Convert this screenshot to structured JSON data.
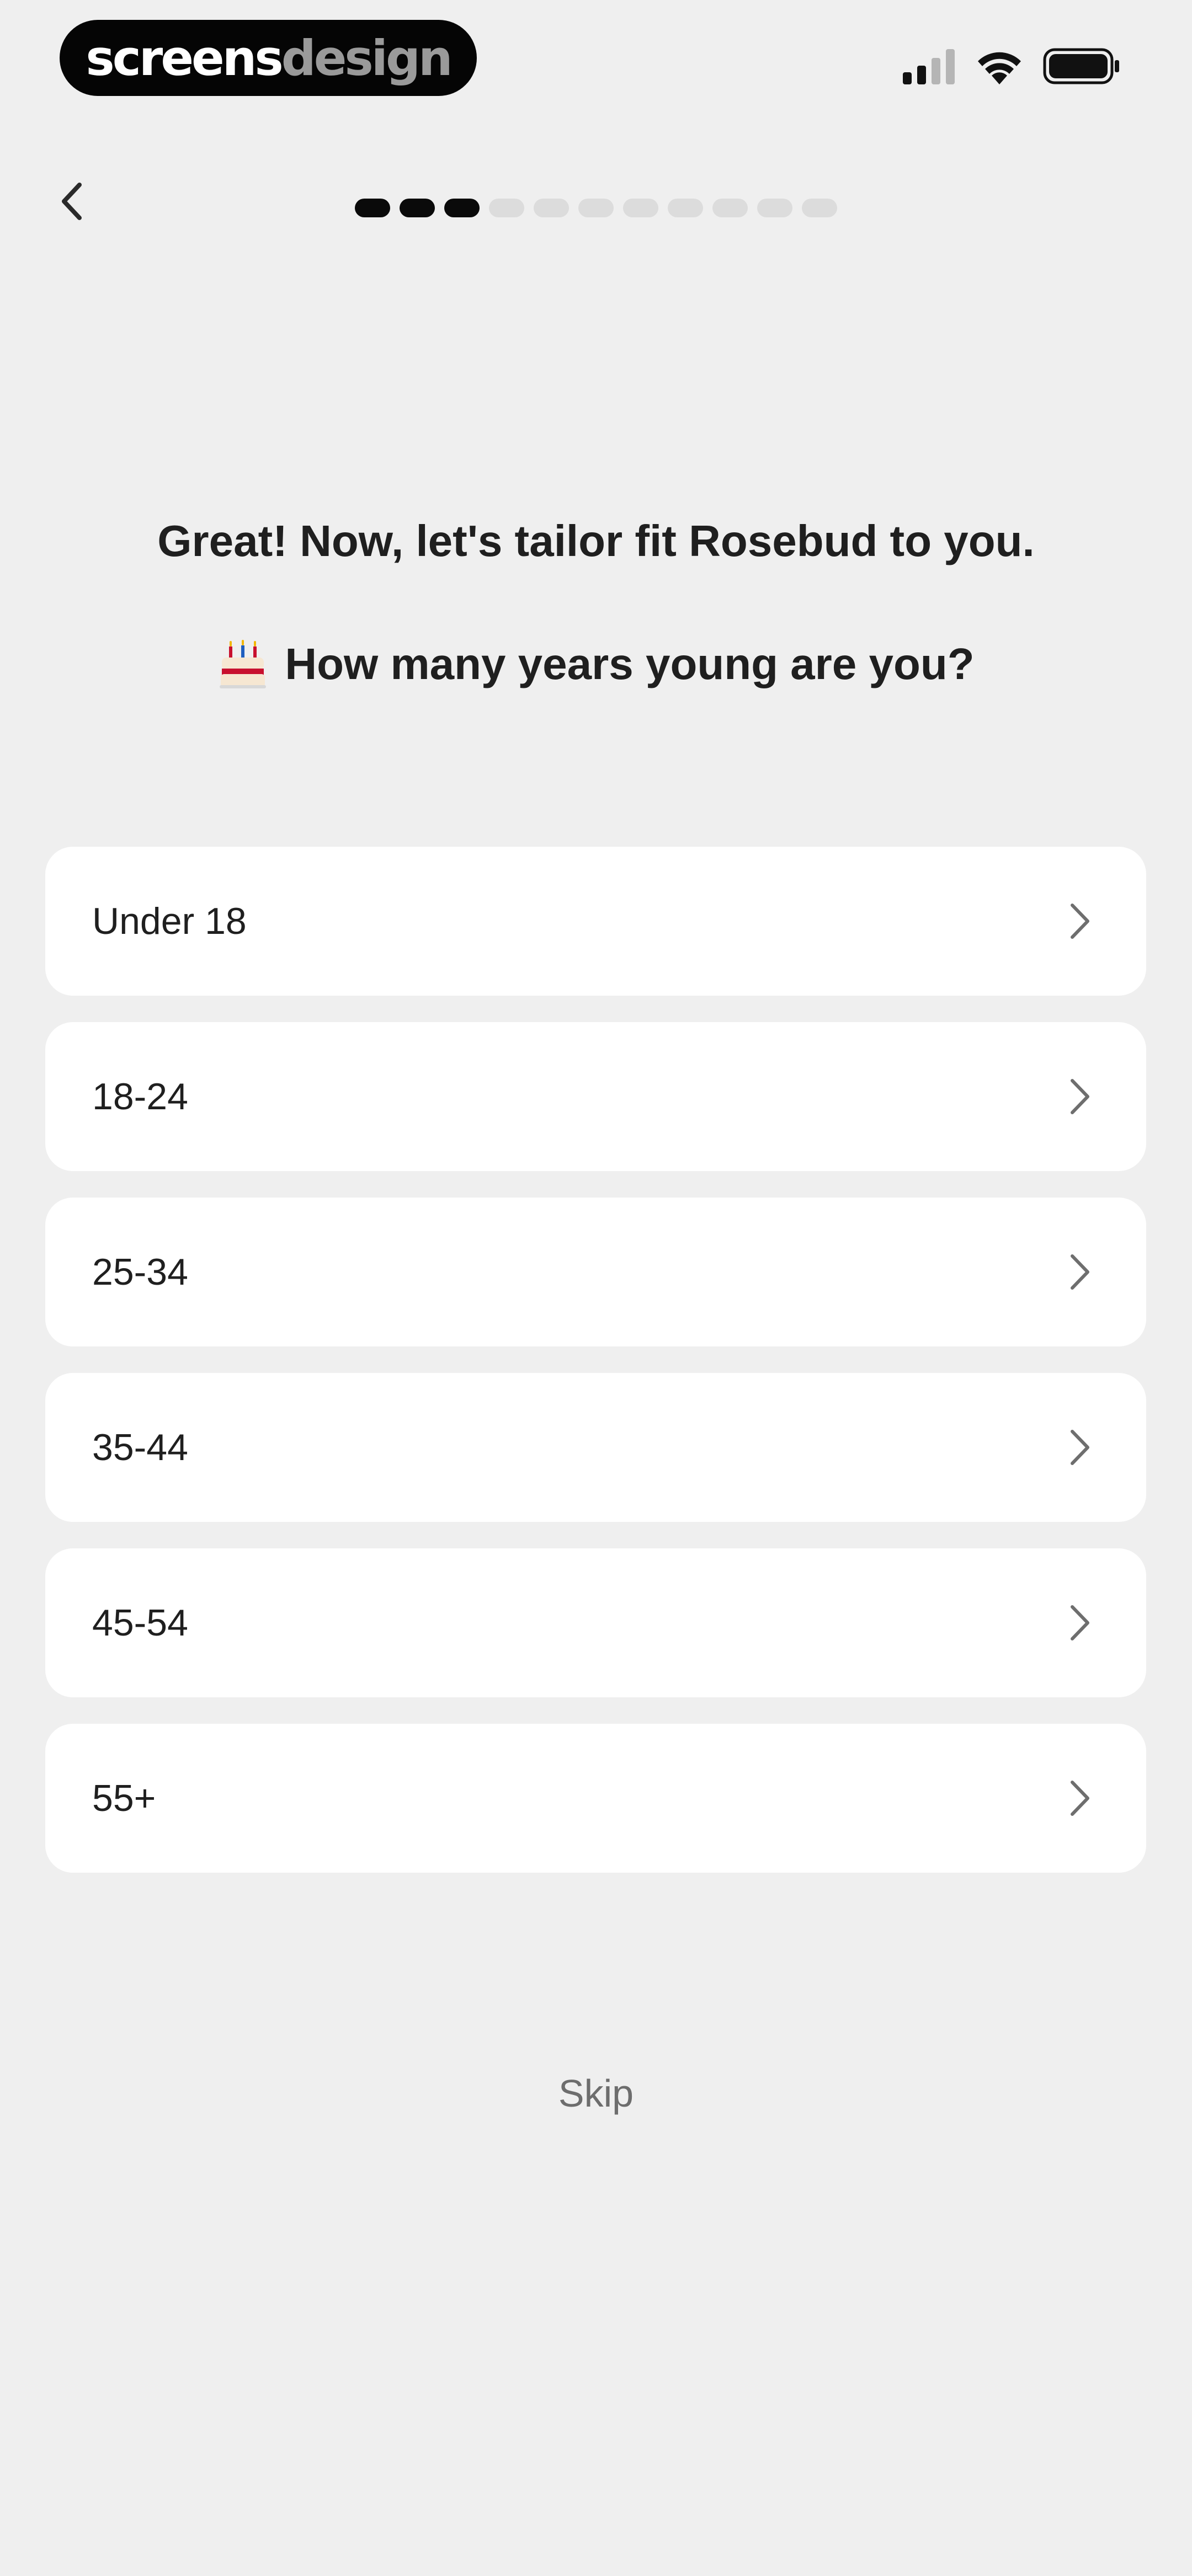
{
  "status_bar": {
    "brand_part1": "screens",
    "brand_part2": "design",
    "icons": [
      "signal-icon",
      "wifi-icon",
      "battery-icon"
    ]
  },
  "nav": {
    "back_icon": "chevron-left-icon",
    "progress": {
      "completed_steps": 3,
      "total_steps": 11
    }
  },
  "main": {
    "title": "Great! Now, let's tailor fit Rosebud to you.",
    "question": "How many years young are you?",
    "question_emoji": "birthday-cake-icon",
    "options": [
      {
        "label": "Under 18"
      },
      {
        "label": "18-24"
      },
      {
        "label": "25-34"
      },
      {
        "label": "35-44"
      },
      {
        "label": "45-54"
      },
      {
        "label": "55+"
      }
    ],
    "skip_label": "Skip"
  },
  "colors": {
    "background": "#efefef",
    "card": "#ffffff",
    "progress_active": "#0a0a0a",
    "progress_inactive": "#dcdcdc",
    "skip_text": "#6d6d6d"
  }
}
